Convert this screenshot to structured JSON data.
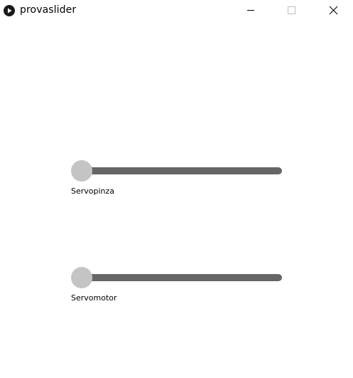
{
  "window": {
    "title": "provaslider",
    "icon": "play-circle-icon",
    "controls": {
      "minimize": "minimize-icon",
      "maximize": "maximize-icon",
      "close": "close-icon"
    }
  },
  "sliders": [
    {
      "label": "Servopinza",
      "value": 0
    },
    {
      "label": "Servomotor",
      "value": 0
    }
  ],
  "colors": {
    "track": "#666666",
    "handle": "#c4c4c4",
    "background": "#ffffff"
  }
}
